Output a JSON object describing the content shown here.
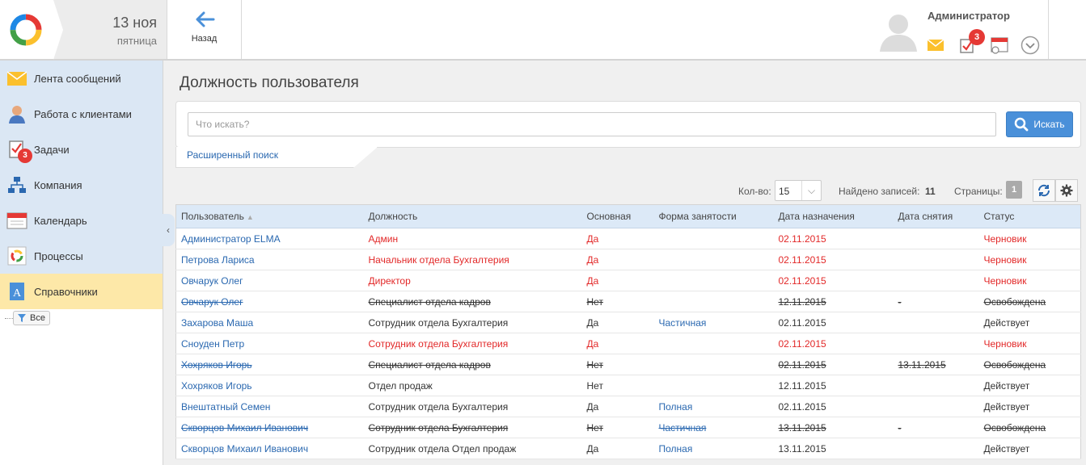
{
  "header": {
    "date_day": "13 ноя",
    "date_weekday": "пятница",
    "back_label": "Назад",
    "user_name": "Администратор",
    "tasks_badge": "3"
  },
  "sidebar": {
    "items": [
      {
        "label": "Лента сообщений",
        "icon": "messages-icon"
      },
      {
        "label": "Работа с клиентами",
        "icon": "clients-icon"
      },
      {
        "label": "Задачи",
        "icon": "tasks-icon",
        "badge": "3"
      },
      {
        "label": "Компания",
        "icon": "company-icon"
      },
      {
        "label": "Календарь",
        "icon": "calendar-icon"
      },
      {
        "label": "Процессы",
        "icon": "processes-icon"
      },
      {
        "label": "Справочники",
        "icon": "directories-icon",
        "active": true
      }
    ],
    "tree_filter": "Все"
  },
  "main": {
    "title": "Должность пользователя",
    "search": {
      "placeholder": "Что искать?",
      "value": "",
      "button_label": "Искать",
      "advanced_link": "Расширенный поиск"
    },
    "toolbar": {
      "count_label": "Кол-во:",
      "count_value": "15",
      "found_label": "Найдено записей:",
      "found_value": "11",
      "pages_label": "Страницы:",
      "page_value": "1"
    },
    "table": {
      "columns": [
        "Пользователь",
        "Должность",
        "Основная",
        "Форма занятости",
        "Дата назначения",
        "Дата снятия",
        "Статус"
      ],
      "rows": [
        {
          "user": "Администратор ELMA",
          "position": "Админ",
          "main": "Да",
          "employment": "",
          "assigned": "02.11.2015",
          "removed": "",
          "status": "Черновик",
          "style": "draft"
        },
        {
          "user": "Петрова Лариса",
          "position": "Начальник отдела Бухгалтерия",
          "main": "Да",
          "employment": "",
          "assigned": "02.11.2015",
          "removed": "",
          "status": "Черновик",
          "style": "draft"
        },
        {
          "user": "Овчарук Олег",
          "position": "Директор",
          "main": "Да",
          "employment": "",
          "assigned": "02.11.2015",
          "removed": "",
          "status": "Черновик",
          "style": "draft"
        },
        {
          "user": "Овчарук Олег",
          "position": "Специалист отдела кадров",
          "main": "Нет",
          "employment": "",
          "assigned": "12.11.2015",
          "removed": "-",
          "status": "Освобождена",
          "style": "released"
        },
        {
          "user": "Захарова Маша",
          "position": "Сотрудник отдела Бухгалтерия",
          "main": "Да",
          "employment": "Частичная",
          "assigned": "02.11.2015",
          "removed": "",
          "status": "Действует",
          "style": "active"
        },
        {
          "user": "Сноуден Петр",
          "position": "Сотрудник отдела Бухгалтерия",
          "main": "Да",
          "employment": "",
          "assigned": "02.11.2015",
          "removed": "",
          "status": "Черновик",
          "style": "draft"
        },
        {
          "user": "Хохряков Игорь",
          "position": "Специалист отдела кадров",
          "main": "Нет",
          "employment": "",
          "assigned": "02.11.2015",
          "removed": "13.11.2015",
          "status": "Освобождена",
          "style": "released"
        },
        {
          "user": "Хохряков Игорь",
          "position": "Отдел продаж",
          "main": "Нет",
          "employment": "",
          "assigned": "12.11.2015",
          "removed": "",
          "status": "Действует",
          "style": "active"
        },
        {
          "user": "Внештатный Семен",
          "position": "Сотрудник отдела Бухгалтерия",
          "main": "Да",
          "employment": "Полная",
          "assigned": "02.11.2015",
          "removed": "",
          "status": "Действует",
          "style": "active"
        },
        {
          "user": "Скворцов Михаил Иванович",
          "position": "Сотрудник отдела Бухгалтерия",
          "main": "Нет",
          "employment": "Частичная",
          "assigned": "13.11.2015",
          "removed": "-",
          "status": "Освобождена",
          "style": "released"
        },
        {
          "user": "Скворцов Михаил Иванович",
          "position": "Сотрудник отдела Отдел продаж",
          "main": "Да",
          "employment": "Полная",
          "assigned": "13.11.2015",
          "removed": "",
          "status": "Действует",
          "style": "active"
        }
      ]
    }
  },
  "colors": {
    "accent": "#4a90d9",
    "draft": "#e22828",
    "link": "#2a68b0",
    "active_nav": "#fde8a8"
  }
}
